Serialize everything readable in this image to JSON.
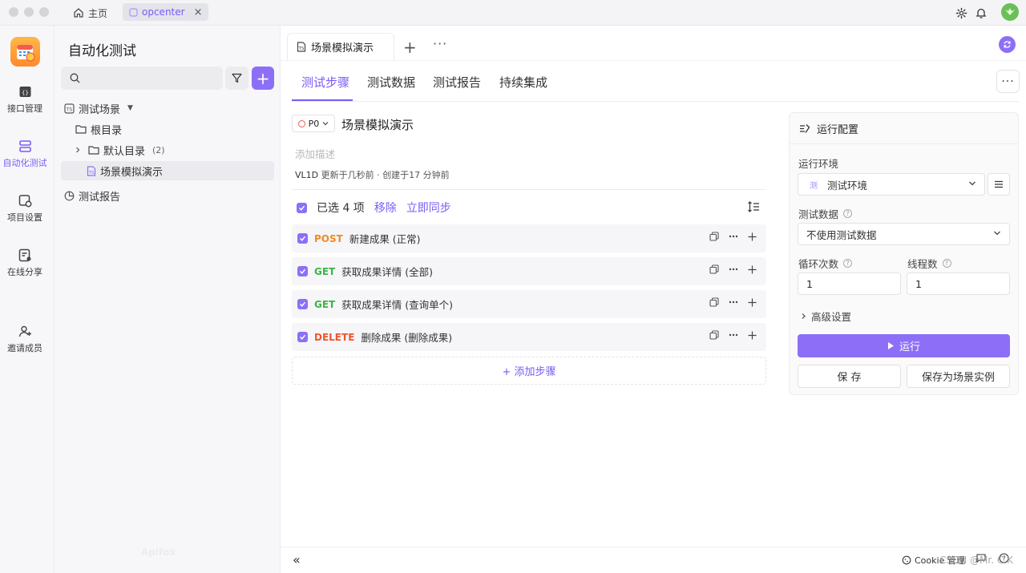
{
  "titlebar": {
    "home_label": "主页",
    "project_tab": "opcenter",
    "close_glyph": "×"
  },
  "rail": [
    {
      "label": "接口管理",
      "icon": "api-icon"
    },
    {
      "label": "自动化测试",
      "icon": "automation-icon",
      "active": true
    },
    {
      "label": "项目设置",
      "icon": "project-settings-icon"
    },
    {
      "label": "在线分享",
      "icon": "share-icon"
    },
    {
      "label": "邀请成员",
      "icon": "invite-user-icon"
    }
  ],
  "tree": {
    "title": "自动化测试",
    "search_placeholder": "",
    "add_glyph": "+",
    "scenes_label": "测试场景",
    "root_label": "根目录",
    "default_dir_label": "默认目录",
    "default_dir_count": "(2)",
    "scene_item_label": "场景模拟演示",
    "report_label": "测试报告"
  },
  "main": {
    "doc_tab": "场景模拟演示",
    "tab_add_glyph": "+",
    "tab_more_glyph": "···",
    "sub_tabs": [
      "测试步骤",
      "测试数据",
      "测试报告",
      "持续集成"
    ],
    "more_glyph": "···",
    "priority": "P0",
    "scene_title": "场景模拟演示",
    "description_placeholder": "添加描述",
    "meta_user": "VL1D",
    "meta_text": "更新于几秒前 · 创建于17 分钟前",
    "selected_text": "已选 4 项",
    "remove_label": "移除",
    "sync_label": "立即同步",
    "steps": [
      {
        "method": "POST",
        "color": "#f08a24",
        "name": "新建成果 (正常)"
      },
      {
        "method": "GET",
        "color": "#3cb34a",
        "name": "获取成果详情 (全部)"
      },
      {
        "method": "GET",
        "color": "#3cb34a",
        "name": "获取成果详情 (查询单个)"
      },
      {
        "method": "DELETE",
        "color": "#f0552c",
        "name": "删除成果 (删除成果)"
      }
    ],
    "add_step_label": "+ 添加步骤"
  },
  "run_config": {
    "title": "运行配置",
    "env_label": "运行环境",
    "env_tag": "测",
    "env_value": "测试环境",
    "data_label": "测试数据",
    "data_value": "不使用测试数据",
    "loop_label": "循环次数",
    "loop_value": "1",
    "thread_label": "线程数",
    "thread_value": "1",
    "help_glyph": "?",
    "advanced_label": "高级设置",
    "run_label": "运行",
    "save_label": "保 存",
    "save_instance_label": "保存为场景实例"
  },
  "footer": {
    "collapse_glyph": "«",
    "cookie_label": "Cookie 管理",
    "watermark": "CSDN @Mr. C.K",
    "ghost_logo": "Apifox"
  },
  "colors": {
    "accent": "#7a5af8",
    "accent_button": "#8d6ff7",
    "post": "#f08a24",
    "get": "#3cb34a",
    "delete": "#f0552c"
  }
}
